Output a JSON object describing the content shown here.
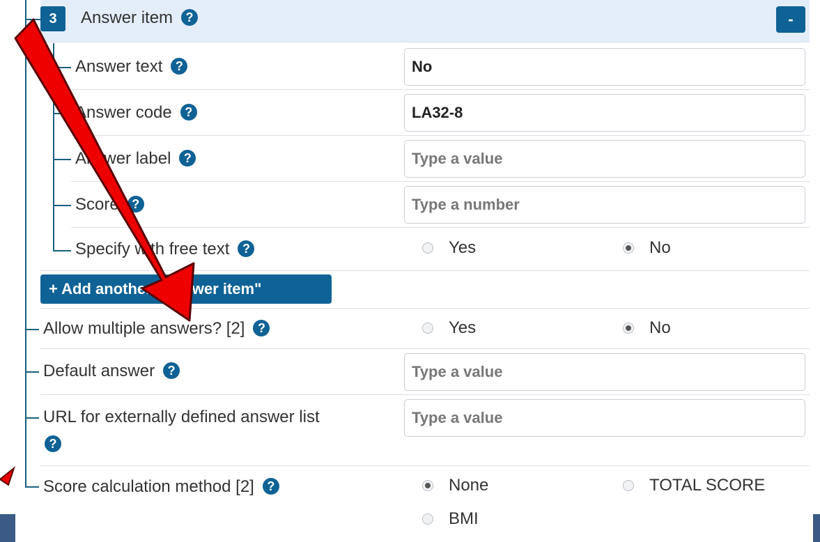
{
  "answer_item": {
    "number": "3",
    "title": "Answer item",
    "collapse_label": "-",
    "answer_text": {
      "label": "Answer text",
      "value": "No"
    },
    "answer_code": {
      "label": "Answer code",
      "value": "LA32-8"
    },
    "answer_label": {
      "label": "Answer label",
      "placeholder": "Type a value"
    },
    "score": {
      "label": "Score",
      "placeholder": "Type a number"
    },
    "specify_free_text": {
      "label": "Specify with free text",
      "options": [
        "Yes",
        "No"
      ],
      "selected": "No"
    }
  },
  "add_button_label": "+ Add another \"Answer item\"",
  "allow_multiple": {
    "label": "Allow multiple answers? [2]",
    "options": [
      "Yes",
      "No"
    ],
    "selected": "No"
  },
  "default_answer": {
    "label": "Default answer",
    "placeholder": "Type a value"
  },
  "url_answer_list": {
    "label": "URL for externally defined answer list",
    "placeholder": "Type a value"
  },
  "score_calc": {
    "label": "Score calculation method [2]",
    "options": [
      "None",
      "TOTAL SCORE",
      "BMI"
    ],
    "selected": "None"
  },
  "help_icon_glyph": "?",
  "colors": {
    "primary": "#0f6296",
    "tree_line": "#17607d",
    "header_bg": "#e4eefb",
    "annotation_arrow": "#ee0000"
  }
}
